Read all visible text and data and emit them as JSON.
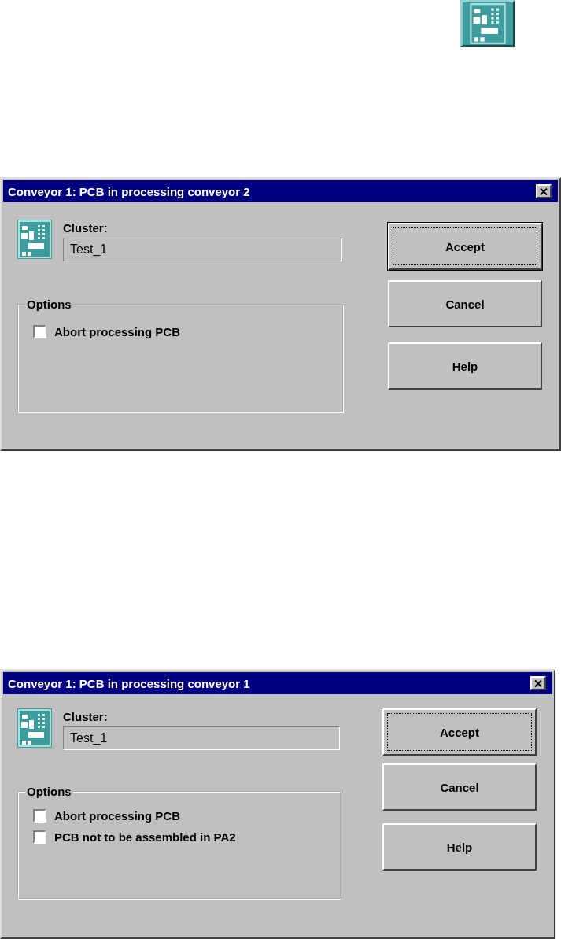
{
  "dialogs": [
    {
      "title": "Conveyor 1: PCB in processing conveyor 2",
      "cluster_label": "Cluster:",
      "cluster_value": "Test_1",
      "options_label": "Options",
      "options": [
        {
          "label": "Abort processing PCB",
          "checked": false
        }
      ],
      "buttons": [
        {
          "label": "Accept",
          "default": true
        },
        {
          "label": "Cancel",
          "default": false
        },
        {
          "label": "Help",
          "default": false
        }
      ]
    },
    {
      "title": "Conveyor 1: PCB in processing conveyor 1",
      "cluster_label": "Cluster:",
      "cluster_value": "Test_1",
      "options_label": "Options",
      "options": [
        {
          "label": "Abort processing PCB",
          "checked": false
        },
        {
          "label": "PCB not to be assembled in PA2",
          "checked": false
        }
      ],
      "buttons": [
        {
          "label": "Accept",
          "default": true
        },
        {
          "label": "Cancel",
          "default": false
        },
        {
          "label": "Help",
          "default": false
        }
      ]
    }
  ]
}
